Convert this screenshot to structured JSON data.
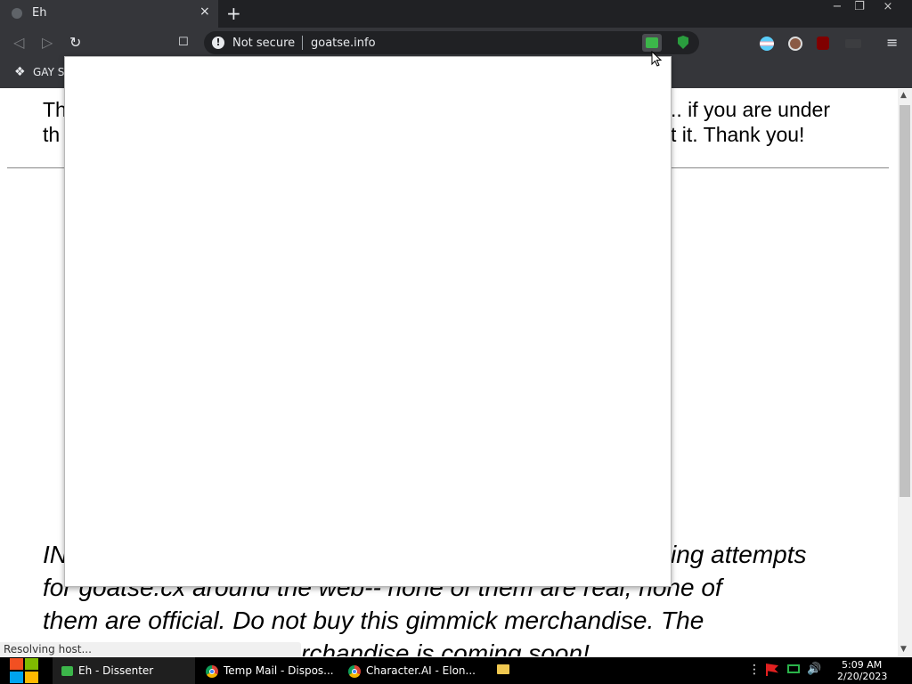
{
  "browser": {
    "tab": {
      "title": "Eh",
      "close": "×"
    },
    "new_tab": "+",
    "window_controls": {
      "minimize": "−",
      "restore": "❐",
      "close": "×"
    },
    "nav": {
      "back": "◁",
      "forward": "▷",
      "reload": "↻",
      "bookmark": "☐"
    },
    "address": {
      "security": "Not secure",
      "url": "goatse.info",
      "info_glyph": "!"
    },
    "menu": "≡",
    "bookmark_bar": {
      "item_label": "GAY S"
    },
    "status": "Resolving host..."
  },
  "page": {
    "top_lines": [
      {
        "left": "Th",
        "right": ".. if you are under"
      },
      {
        "left": "th",
        "right": "t it. Thank you!"
      }
    ],
    "bottom_lines": [
      {
        "left": "IN",
        "right": "ing attempts"
      },
      {
        "left": "",
        "right": "for goatse.cx around the web-- none of them are real, none of"
      },
      {
        "left": "",
        "right": "them are official. Do not buy this gimmick merchandise. The"
      },
      {
        "left": "",
        "right": "rchandise is coming soon!"
      }
    ]
  },
  "taskbar": {
    "items": [
      {
        "label": "Eh - Dissenter"
      },
      {
        "label": "Temp Mail - Dispos..."
      },
      {
        "label": "Character.AI - Elon..."
      }
    ],
    "time": "5:09 AM",
    "date": "2/20/2023"
  },
  "colors": {
    "dissenter_green": "#3cb64a",
    "chrome_dark": "#202124",
    "toolbar": "#35363a"
  }
}
